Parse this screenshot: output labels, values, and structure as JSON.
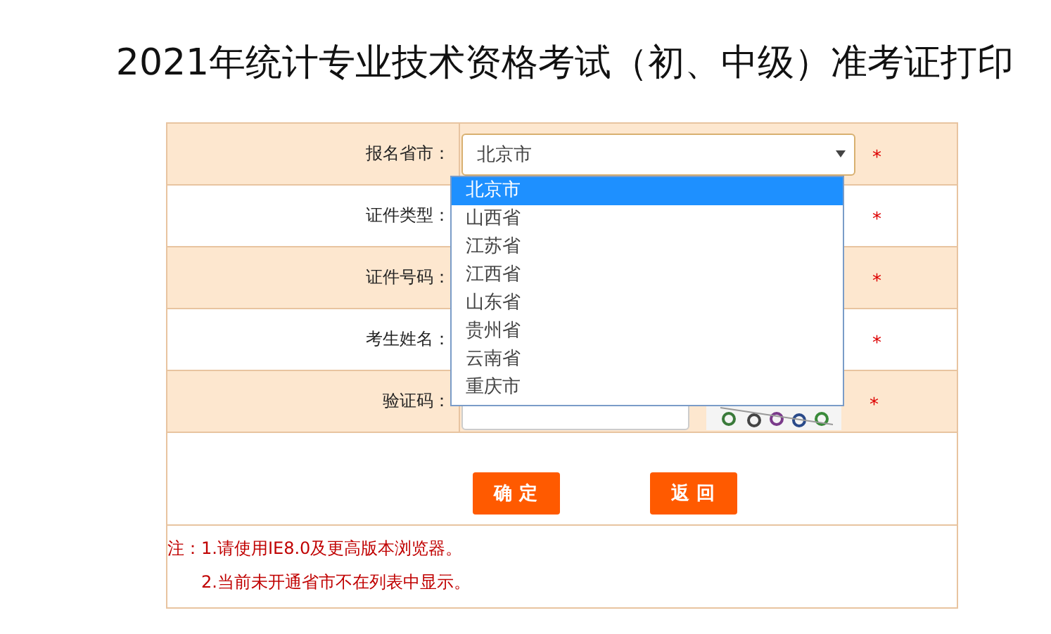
{
  "title": "2021年统计专业技术资格考试（初、中级）准考证打印",
  "form": {
    "rows": [
      {
        "label": "报名省市：",
        "kind": "select",
        "value": "北京市",
        "mark": "*"
      },
      {
        "label": "证件类型：",
        "kind": "covered",
        "mark": "*"
      },
      {
        "label": "证件号码：",
        "kind": "covered",
        "mark": "*"
      },
      {
        "label": "考生姓名：",
        "kind": "covered",
        "mark": "*"
      },
      {
        "label": "验证码：",
        "kind": "captcha",
        "mark": "*"
      }
    ],
    "dropdown": {
      "options": [
        {
          "label": "北京市",
          "selected": true
        },
        {
          "label": "山西省",
          "selected": false
        },
        {
          "label": "江苏省",
          "selected": false
        },
        {
          "label": "江西省",
          "selected": false
        },
        {
          "label": "山东省",
          "selected": false
        },
        {
          "label": "贵州省",
          "selected": false
        },
        {
          "label": "云南省",
          "selected": false
        },
        {
          "label": "重庆市",
          "selected": false
        }
      ]
    },
    "buttons": [
      "确 定",
      "返 回"
    ],
    "notes": [
      "注：1.请使用IE8.0及更高版本浏览器。",
      "2.当前未开通省市不在列表中显示。"
    ]
  }
}
